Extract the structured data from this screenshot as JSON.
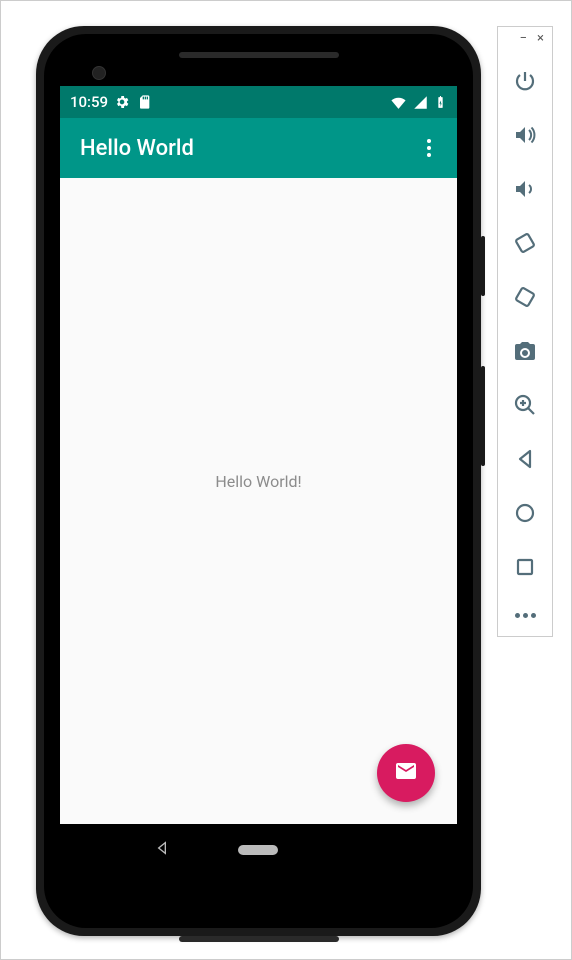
{
  "status_bar": {
    "time": "10:59",
    "icons_left": [
      "gear-icon",
      "sd-card-icon"
    ],
    "icons_right": [
      "wifi-icon",
      "signal-icon",
      "battery-charging-icon"
    ]
  },
  "app_bar": {
    "title": "Hello World"
  },
  "content": {
    "text": "Hello World!"
  },
  "fab": {
    "icon": "mail-icon"
  },
  "nav_bar": {
    "back": "back",
    "home": "home"
  },
  "emulator_toolbar": {
    "minimize": "−",
    "close": "×",
    "buttons": [
      "power-icon",
      "volume-up-icon",
      "volume-down-icon",
      "rotate-left-icon",
      "rotate-right-icon",
      "camera-icon",
      "zoom-in-icon",
      "nav-back-icon",
      "nav-home-icon",
      "nav-overview-icon"
    ],
    "more": "more-icon"
  },
  "colors": {
    "primary": "#009688",
    "primaryDark": "#00796b",
    "accent": "#d81b60",
    "toolIcon": "#546e7a"
  }
}
